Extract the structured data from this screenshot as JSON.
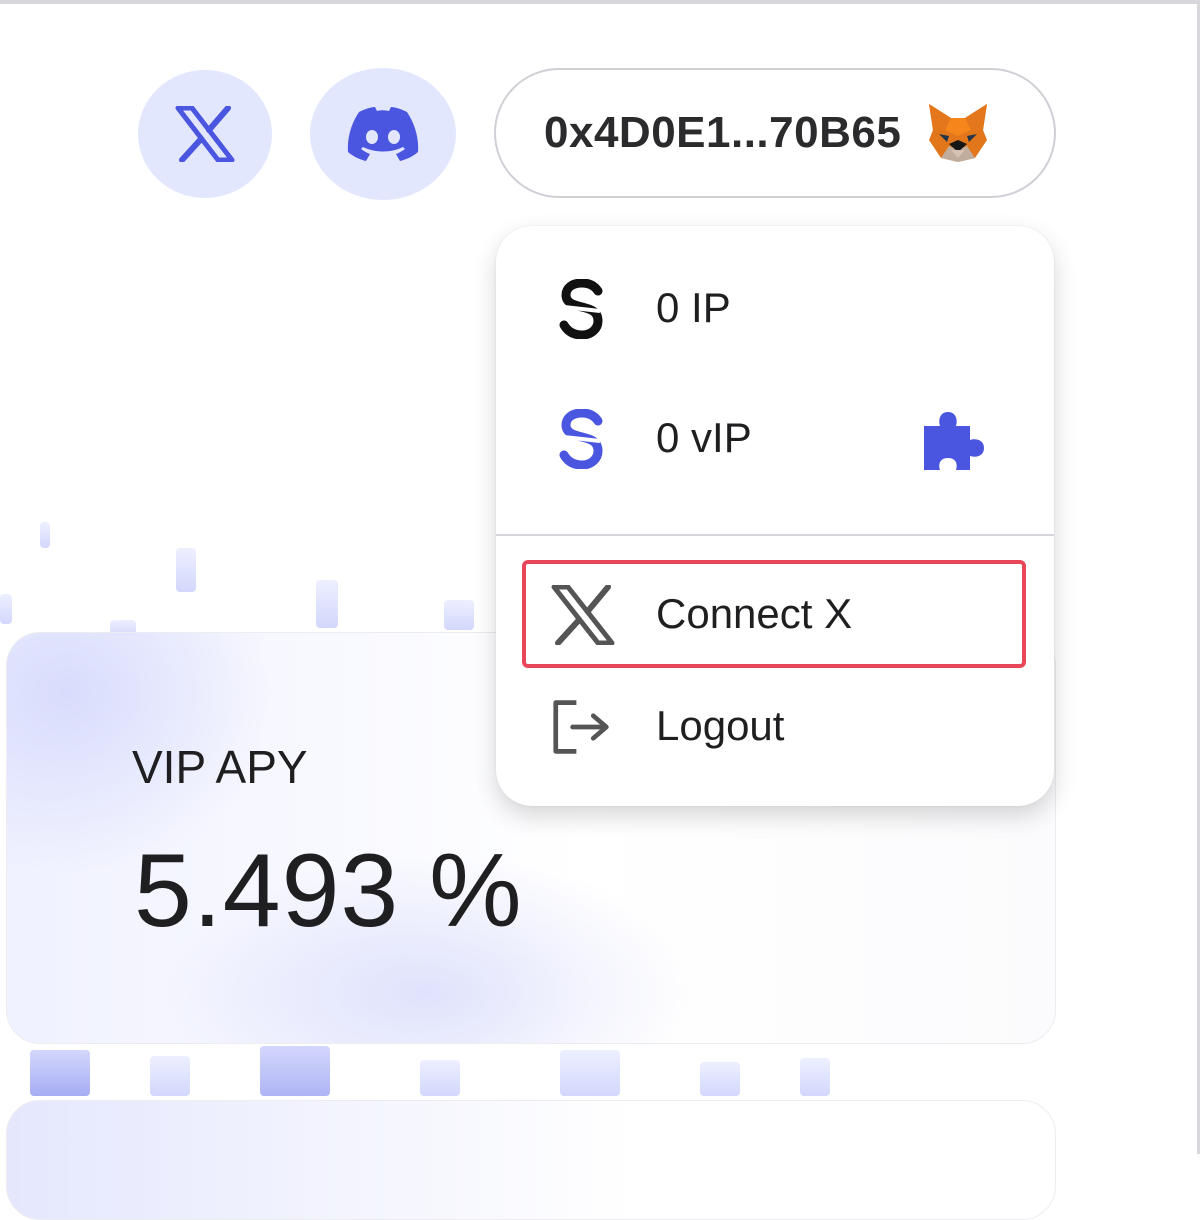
{
  "header": {
    "social": [
      {
        "name": "X",
        "icon": "x-logo-icon"
      },
      {
        "name": "Discord",
        "icon": "discord-icon"
      }
    ],
    "wallet": {
      "address": "0x4D0E1...70B65",
      "icon": "metamask-fox-icon"
    }
  },
  "dropdown": {
    "balances": [
      {
        "label": "0 IP",
        "icon": "s-token-icon-black"
      },
      {
        "label": "0 vIP",
        "icon": "s-token-icon-blue",
        "extra_icon": "puzzle-extension-icon"
      }
    ],
    "actions": [
      {
        "label": "Connect X",
        "icon": "x-logo-icon",
        "highlighted": true
      },
      {
        "label": "Logout",
        "icon": "logout-icon"
      }
    ]
  },
  "stats": {
    "vip_apy_label": "VIP APY",
    "vip_apy_value": "5.493 %"
  },
  "colors": {
    "accent": "#4a55e0",
    "social_bg": "#e3e7fe",
    "highlight": "#e8475a"
  }
}
